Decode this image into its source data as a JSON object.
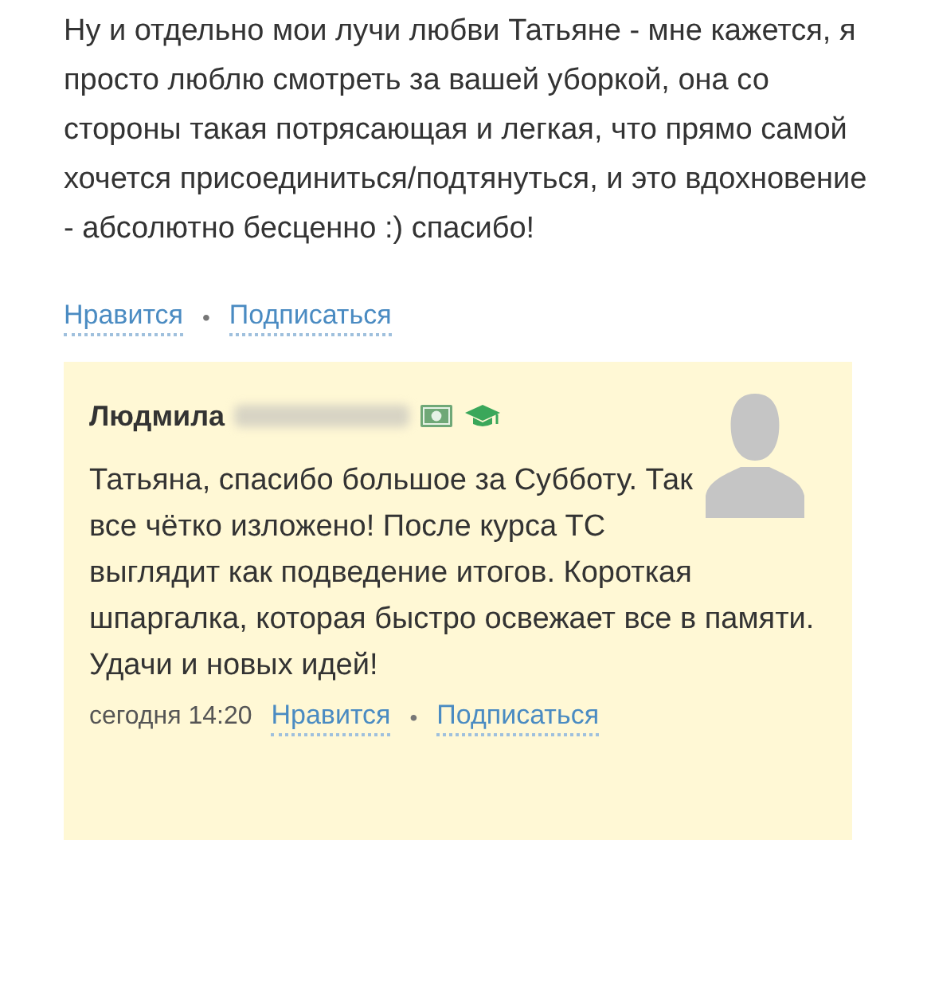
{
  "post": {
    "text": "Ну и отдельно мои лучи любви Татьяне - мне кажется, я просто люблю смотреть за вашей уборкой, она со стороны такая потрясающая и легкая, что прямо самой хочется присоединиться/подтянуться, и это вдохновение - абсолютно бесценно :) спасибо!",
    "actions": [
      {
        "label": "Нравится"
      },
      {
        "label": "•",
        "kind": "separator"
      },
      {
        "label": "Подписаться"
      }
    ]
  },
  "reply": {
    "author": "Людмила",
    "surname_hidden": true,
    "badges": [
      {
        "kind": "money"
      },
      {
        "kind": "graduate"
      }
    ],
    "text": "Татьяна, спасибо большое за Субботу. Так все чётко изложено! После курса ТС выглядит как подведение итогов. Короткая шпаргалка, которая быстро освежает все в памяти. Удачи и новых идей!",
    "time": "сегодня 14:20",
    "actions": [
      {
        "label": "Нравится"
      },
      {
        "label": "•",
        "kind": "separator"
      },
      {
        "label": "Подписаться"
      }
    ]
  }
}
